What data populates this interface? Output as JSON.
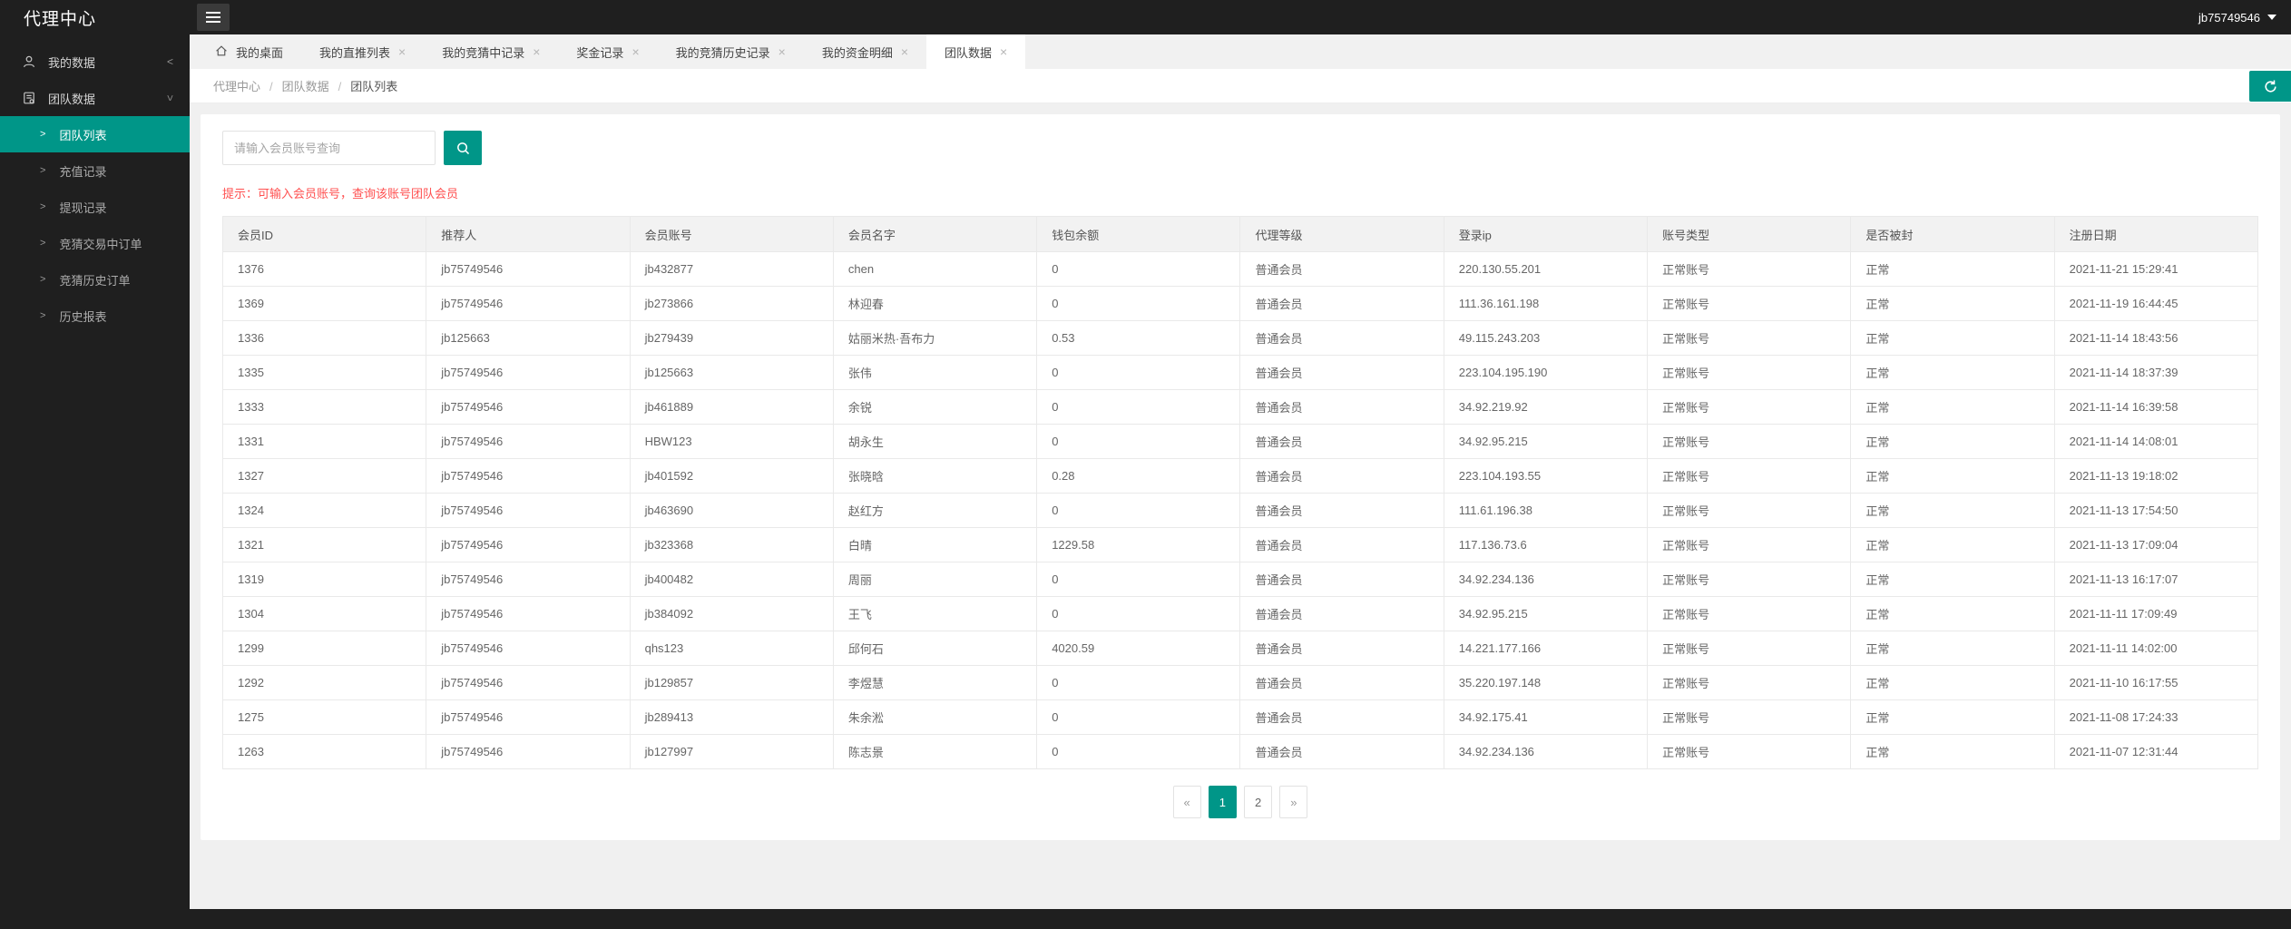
{
  "colors": {
    "accent": "#009688",
    "chrome_dark": "#1f1f1f",
    "hint_text": "#ff5050",
    "content_bg": "#f0f0f0"
  },
  "header": {
    "title": "代理中心",
    "username": "jb75749546"
  },
  "tabs": [
    {
      "label": "我的桌面",
      "home": true,
      "closable": false,
      "active": false
    },
    {
      "label": "我的直推列表",
      "home": false,
      "closable": true,
      "active": false
    },
    {
      "label": "我的竞猜中记录",
      "home": false,
      "closable": true,
      "active": false
    },
    {
      "label": "奖金记录",
      "home": false,
      "closable": true,
      "active": false
    },
    {
      "label": "我的竞猜历史记录",
      "home": false,
      "closable": true,
      "active": false
    },
    {
      "label": "我的资金明细",
      "home": false,
      "closable": true,
      "active": false
    },
    {
      "label": "团队数据",
      "home": false,
      "closable": true,
      "active": true
    }
  ],
  "breadcrumb": {
    "items": [
      "代理中心",
      "团队数据",
      "团队列表"
    ],
    "separator": "/"
  },
  "sidebar": {
    "groups": [
      {
        "label": "我的数据",
        "icon": "user-icon",
        "state": "collapsed",
        "children": []
      },
      {
        "label": "团队数据",
        "icon": "report-icon",
        "state": "expanded",
        "children": [
          {
            "label": "团队列表",
            "active": true
          },
          {
            "label": "充值记录",
            "active": false
          },
          {
            "label": "提现记录",
            "active": false
          },
          {
            "label": "竞猜交易中订单",
            "active": false
          },
          {
            "label": "竞猜历史订单",
            "active": false
          },
          {
            "label": "历史报表",
            "active": false
          }
        ]
      }
    ]
  },
  "search": {
    "placeholder": "请输入会员账号查询"
  },
  "hint": {
    "text": "提示：可输入会员账号，查询该账号团队会员"
  },
  "table": {
    "headers": [
      "会员ID",
      "推荐人",
      "会员账号",
      "会员名字",
      "钱包余额",
      "代理等级",
      "登录ip",
      "账号类型",
      "是否被封",
      "注册日期"
    ],
    "rows": [
      [
        "1376",
        "jb75749546",
        "jb432877",
        "chen",
        "0",
        "普通会员",
        "220.130.55.201",
        "正常账号",
        "正常",
        "2021-11-21 15:29:41"
      ],
      [
        "1369",
        "jb75749546",
        "jb273866",
        "林迎春",
        "0",
        "普通会员",
        "111.36.161.198",
        "正常账号",
        "正常",
        "2021-11-19 16:44:45"
      ],
      [
        "1336",
        "jb125663",
        "jb279439",
        "姑丽米热·吾布力",
        "0.53",
        "普通会员",
        "49.115.243.203",
        "正常账号",
        "正常",
        "2021-11-14 18:43:56"
      ],
      [
        "1335",
        "jb75749546",
        "jb125663",
        "张伟",
        "0",
        "普通会员",
        "223.104.195.190",
        "正常账号",
        "正常",
        "2021-11-14 18:37:39"
      ],
      [
        "1333",
        "jb75749546",
        "jb461889",
        "余锐",
        "0",
        "普通会员",
        "34.92.219.92",
        "正常账号",
        "正常",
        "2021-11-14 16:39:58"
      ],
      [
        "1331",
        "jb75749546",
        "HBW123",
        "胡永生",
        "0",
        "普通会员",
        "34.92.95.215",
        "正常账号",
        "正常",
        "2021-11-14 14:08:01"
      ],
      [
        "1327",
        "jb75749546",
        "jb401592",
        "张晓晗",
        "0.28",
        "普通会员",
        "223.104.193.55",
        "正常账号",
        "正常",
        "2021-11-13 19:18:02"
      ],
      [
        "1324",
        "jb75749546",
        "jb463690",
        "赵红方",
        "0",
        "普通会员",
        "111.61.196.38",
        "正常账号",
        "正常",
        "2021-11-13 17:54:50"
      ],
      [
        "1321",
        "jb75749546",
        "jb323368",
        "白晴",
        "1229.58",
        "普通会员",
        "117.136.73.6",
        "正常账号",
        "正常",
        "2021-11-13 17:09:04"
      ],
      [
        "1319",
        "jb75749546",
        "jb400482",
        "周丽",
        "0",
        "普通会员",
        "34.92.234.136",
        "正常账号",
        "正常",
        "2021-11-13 16:17:07"
      ],
      [
        "1304",
        "jb75749546",
        "jb384092",
        "王飞",
        "0",
        "普通会员",
        "34.92.95.215",
        "正常账号",
        "正常",
        "2021-11-11 17:09:49"
      ],
      [
        "1299",
        "jb75749546",
        "qhs123",
        "邱何石",
        "4020.59",
        "普通会员",
        "14.221.177.166",
        "正常账号",
        "正常",
        "2021-11-11 14:02:00"
      ],
      [
        "1292",
        "jb75749546",
        "jb129857",
        "李煜慧",
        "0",
        "普通会员",
        "35.220.197.148",
        "正常账号",
        "正常",
        "2021-11-10 16:17:55"
      ],
      [
        "1275",
        "jb75749546",
        "jb289413",
        "朱余淞",
        "0",
        "普通会员",
        "34.92.175.41",
        "正常账号",
        "正常",
        "2021-11-08 17:24:33"
      ],
      [
        "1263",
        "jb75749546",
        "jb127997",
        "陈志景",
        "0",
        "普通会员",
        "34.92.234.136",
        "正常账号",
        "正常",
        "2021-11-07 12:31:44"
      ]
    ]
  },
  "pagination": {
    "prev": "«",
    "next": "»",
    "pages": [
      "1",
      "2"
    ],
    "active": "1"
  }
}
